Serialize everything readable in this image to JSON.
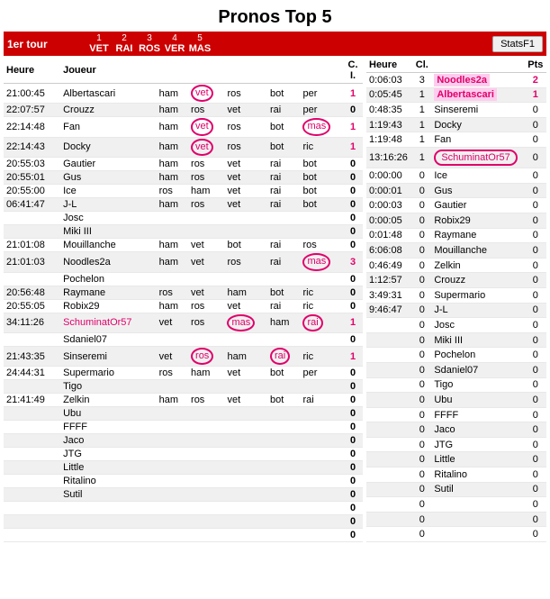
{
  "title": "Pronos Top 5",
  "header": {
    "tour_label": "1er tour",
    "cols": [
      {
        "num": "1",
        "name": "VET"
      },
      {
        "num": "2",
        "name": "RAI"
      },
      {
        "num": "3",
        "name": "ROS"
      },
      {
        "num": "4",
        "name": "VER"
      },
      {
        "num": "5",
        "name": "MAS"
      }
    ],
    "statsf1_label": "StatsF1"
  },
  "left_headers": [
    "Heure",
    "Joueur",
    "",
    "",
    "",
    "",
    "",
    "C. I."
  ],
  "left_rows": [
    {
      "heure": "21:00:45",
      "joueur": "Albertascari",
      "c1": "ham",
      "c2": "vet",
      "c3": "ros",
      "c4": "bot",
      "c5": "per",
      "ci": "1",
      "c2_circle": true
    },
    {
      "heure": "22:07:57",
      "joueur": "Crouzz",
      "c1": "ham",
      "c2": "ros",
      "c3": "vet",
      "c4": "rai",
      "c5": "per",
      "ci": "0"
    },
    {
      "heure": "22:14:48",
      "joueur": "Fan",
      "c1": "ham",
      "c2": "vet",
      "c3": "ros",
      "c4": "bot",
      "c5": "mas",
      "ci": "1",
      "c2_circle": true,
      "c5_circle": true
    },
    {
      "heure": "22:14:43",
      "joueur": "Docky",
      "c1": "ham",
      "c2": "vet",
      "c3": "ros",
      "c4": "bot",
      "c5": "ric",
      "ci": "1",
      "c2_circle": true
    },
    {
      "heure": "20:55:03",
      "joueur": "Gautier",
      "c1": "ham",
      "c2": "ros",
      "c3": "vet",
      "c4": "rai",
      "c5": "bot",
      "ci": "0"
    },
    {
      "heure": "20:55:01",
      "joueur": "Gus",
      "c1": "ham",
      "c2": "ros",
      "c3": "vet",
      "c4": "rai",
      "c5": "bot",
      "ci": "0"
    },
    {
      "heure": "20:55:00",
      "joueur": "Ice",
      "c1": "ros",
      "c2": "ham",
      "c3": "vet",
      "c4": "rai",
      "c5": "bot",
      "ci": "0"
    },
    {
      "heure": "06:41:47",
      "joueur": "J-L",
      "c1": "ham",
      "c2": "ros",
      "c3": "vet",
      "c4": "rai",
      "c5": "bot",
      "ci": "0"
    },
    {
      "heure": "",
      "joueur": "Josc",
      "c1": "",
      "c2": "",
      "c3": "",
      "c4": "",
      "c5": "",
      "ci": "0"
    },
    {
      "heure": "",
      "joueur": "Miki III",
      "c1": "",
      "c2": "",
      "c3": "",
      "c4": "",
      "c5": "",
      "ci": "0"
    },
    {
      "heure": "21:01:08",
      "joueur": "Mouillanche",
      "c1": "ham",
      "c2": "vet",
      "c3": "bot",
      "c4": "rai",
      "c5": "ros",
      "ci": "0"
    },
    {
      "heure": "21:01:03",
      "joueur": "Noodles2a",
      "c1": "ham",
      "c2": "vet",
      "c3": "ros",
      "c4": "rai",
      "c5": "mas",
      "ci": "3",
      "c5_circle": true
    },
    {
      "heure": "",
      "joueur": "Pochelon",
      "c1": "",
      "c2": "",
      "c3": "",
      "c4": "",
      "c5": "",
      "ci": "0"
    },
    {
      "heure": "20:56:48",
      "joueur": "Raymane",
      "c1": "ros",
      "c2": "vet",
      "c3": "ham",
      "c4": "bot",
      "c5": "ric",
      "ci": "0"
    },
    {
      "heure": "20:55:05",
      "joueur": "Robix29",
      "c1": "ham",
      "c2": "ros",
      "c3": "vet",
      "c4": "rai",
      "c5": "ric",
      "ci": "0"
    },
    {
      "heure": "34:11:26",
      "joueur": "SchuminatOr57",
      "c1": "vet",
      "c2": "ros",
      "c3": "mas",
      "c4": "ham",
      "c5": "rai",
      "ci": "1",
      "c3_circle": true,
      "c5_circle": true,
      "highlight": true
    },
    {
      "heure": "",
      "joueur": "Sdaniel07",
      "c1": "",
      "c2": "",
      "c3": "",
      "c4": "",
      "c5": "",
      "ci": "0"
    },
    {
      "heure": "21:43:35",
      "joueur": "Sinseremi",
      "c1": "vet",
      "c2": "ros",
      "c3": "ham",
      "c4": "rai",
      "c5": "ric",
      "ci": "1",
      "c2_circle": true,
      "c4_circle": true
    },
    {
      "heure": "24:44:31",
      "joueur": "Supermario",
      "c1": "ros",
      "c2": "ham",
      "c3": "vet",
      "c4": "bot",
      "c5": "per",
      "ci": "0"
    },
    {
      "heure": "",
      "joueur": "Tigo",
      "c1": "",
      "c2": "",
      "c3": "",
      "c4": "",
      "c5": "",
      "ci": "0"
    },
    {
      "heure": "21:41:49",
      "joueur": "Zelkin",
      "c1": "ham",
      "c2": "ros",
      "c3": "vet",
      "c4": "bot",
      "c5": "rai",
      "ci": "0"
    },
    {
      "heure": "",
      "joueur": "Ubu",
      "c1": "",
      "c2": "",
      "c3": "",
      "c4": "",
      "c5": "",
      "ci": "0"
    },
    {
      "heure": "",
      "joueur": "FFFF",
      "c1": "",
      "c2": "",
      "c3": "",
      "c4": "",
      "c5": "",
      "ci": "0"
    },
    {
      "heure": "",
      "joueur": "Jaco",
      "c1": "",
      "c2": "",
      "c3": "",
      "c4": "",
      "c5": "",
      "ci": "0"
    },
    {
      "heure": "",
      "joueur": "JTG",
      "c1": "",
      "c2": "",
      "c3": "",
      "c4": "",
      "c5": "",
      "ci": "0"
    },
    {
      "heure": "",
      "joueur": "Little",
      "c1": "",
      "c2": "",
      "c3": "",
      "c4": "",
      "c5": "",
      "ci": "0"
    },
    {
      "heure": "",
      "joueur": "Ritalino",
      "c1": "",
      "c2": "",
      "c3": "",
      "c4": "",
      "c5": "",
      "ci": "0"
    },
    {
      "heure": "",
      "joueur": "Sutil",
      "c1": "",
      "c2": "",
      "c3": "",
      "c4": "",
      "c5": "",
      "ci": "0"
    },
    {
      "heure": "",
      "joueur": "",
      "c1": "",
      "c2": "",
      "c3": "",
      "c4": "",
      "c5": "",
      "ci": "0"
    },
    {
      "heure": "",
      "joueur": "",
      "c1": "",
      "c2": "",
      "c3": "",
      "c4": "",
      "c5": "",
      "ci": "0"
    },
    {
      "heure": "",
      "joueur": "",
      "c1": "",
      "c2": "",
      "c3": "",
      "c4": "",
      "c5": "",
      "ci": "0"
    }
  ],
  "right_headers": [
    "Heure",
    "Cl.",
    "Pts"
  ],
  "right_rows": [
    {
      "heure": "0:06:03",
      "joueur": "Noodles2a",
      "cl": "3",
      "pts": "2",
      "highlight_name": true,
      "highlight_pts": true
    },
    {
      "heure": "0:05:45",
      "joueur": "Albertascari",
      "cl": "1",
      "pts": "1",
      "highlight_name": true,
      "highlight_pts": true
    },
    {
      "heure": "0:48:35",
      "joueur": "Sinseremi",
      "cl": "1",
      "pts": "0"
    },
    {
      "heure": "1:19:43",
      "joueur": "Docky",
      "cl": "1",
      "pts": "0"
    },
    {
      "heure": "1:19:48",
      "joueur": "Fan",
      "cl": "1",
      "pts": "0"
    },
    {
      "heure": "13:16:26",
      "joueur": "SchuminatOr57",
      "cl": "1",
      "pts": "0",
      "outline_name": true
    },
    {
      "heure": "0:00:00",
      "joueur": "Ice",
      "cl": "0",
      "pts": "0"
    },
    {
      "heure": "0:00:01",
      "joueur": "Gus",
      "cl": "0",
      "pts": "0"
    },
    {
      "heure": "0:00:03",
      "joueur": "Gautier",
      "cl": "0",
      "pts": "0"
    },
    {
      "heure": "0:00:05",
      "joueur": "Robix29",
      "cl": "0",
      "pts": "0"
    },
    {
      "heure": "0:01:48",
      "joueur": "Raymane",
      "cl": "0",
      "pts": "0"
    },
    {
      "heure": "6:06:08",
      "joueur": "Mouillanche",
      "cl": "0",
      "pts": "0"
    },
    {
      "heure": "0:46:49",
      "joueur": "Zelkin",
      "cl": "0",
      "pts": "0"
    },
    {
      "heure": "1:12:57",
      "joueur": "Crouzz",
      "cl": "0",
      "pts": "0"
    },
    {
      "heure": "3:49:31",
      "joueur": "Supermario",
      "cl": "0",
      "pts": "0"
    },
    {
      "heure": "9:46:47",
      "joueur": "J-L",
      "cl": "0",
      "pts": "0"
    },
    {
      "heure": "",
      "joueur": "Josc",
      "cl": "0",
      "pts": "0"
    },
    {
      "heure": "",
      "joueur": "Miki III",
      "cl": "0",
      "pts": "0"
    },
    {
      "heure": "",
      "joueur": "Pochelon",
      "cl": "0",
      "pts": "0"
    },
    {
      "heure": "",
      "joueur": "Sdaniel07",
      "cl": "0",
      "pts": "0"
    },
    {
      "heure": "",
      "joueur": "Tigo",
      "cl": "0",
      "pts": "0"
    },
    {
      "heure": "",
      "joueur": "Ubu",
      "cl": "0",
      "pts": "0"
    },
    {
      "heure": "",
      "joueur": "FFFF",
      "cl": "0",
      "pts": "0"
    },
    {
      "heure": "",
      "joueur": "Jaco",
      "cl": "0",
      "pts": "0"
    },
    {
      "heure": "",
      "joueur": "JTG",
      "cl": "0",
      "pts": "0"
    },
    {
      "heure": "",
      "joueur": "Little",
      "cl": "0",
      "pts": "0"
    },
    {
      "heure": "",
      "joueur": "Ritalino",
      "cl": "0",
      "pts": "0"
    },
    {
      "heure": "",
      "joueur": "Sutil",
      "cl": "0",
      "pts": "0"
    },
    {
      "heure": "",
      "joueur": "",
      "cl": "0",
      "pts": "0"
    },
    {
      "heure": "",
      "joueur": "",
      "cl": "0",
      "pts": "0"
    },
    {
      "heure": "",
      "joueur": "",
      "cl": "0",
      "pts": "0"
    }
  ]
}
